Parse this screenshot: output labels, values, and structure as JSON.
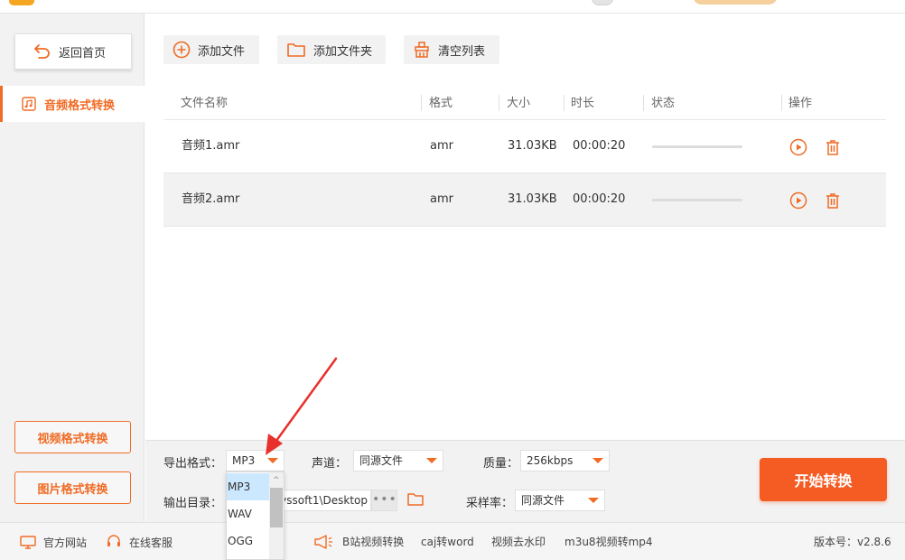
{
  "sidebar": {
    "back_label": "返回首页",
    "active_item": "音频格式转换",
    "video_btn": "视频格式转换",
    "image_btn": "图片格式转换"
  },
  "toolbar": {
    "add_file": "添加文件",
    "add_folder": "添加文件夹",
    "clear_list": "清空列表"
  },
  "table": {
    "headers": {
      "name": "文件名称",
      "format": "格式",
      "size": "大小",
      "duration": "时长",
      "status": "状态",
      "actions": "操作"
    },
    "rows": [
      {
        "name": "音频1.amr",
        "format": "amr",
        "size": "31.03KB",
        "duration": "00:00:20",
        "progress": 0
      },
      {
        "name": "音频2.amr",
        "format": "amr",
        "size": "31.03KB",
        "duration": "00:00:20",
        "progress": 0
      }
    ]
  },
  "settings": {
    "export_format_label": "导出格式：",
    "export_format_value": "MP3",
    "channel_label": "声道：",
    "channel_value": "同源文件",
    "quality_label": "质量：",
    "quality_value": "256kbps",
    "output_dir_label": "输出目录：",
    "output_dir_value": "yssoft1\\Desktop",
    "sample_rate_label": "采样率：",
    "sample_rate_value": "同源文件",
    "dots": "•••",
    "start_button": "开始转换",
    "format_options": [
      "MP3",
      "WAV",
      "OGG"
    ]
  },
  "footer": {
    "website": "官方网站",
    "support": "在线客服",
    "links": [
      "B站视频转换",
      "caj转word",
      "视频去水印",
      "m3u8视频转mp4"
    ],
    "version": "版本号：v2.8.6"
  },
  "colors": {
    "accent": "#f06b24",
    "start_button": "#f55c23",
    "dropdown_selected": "#cce8ff",
    "annotation_arrow": "#e8302c"
  }
}
